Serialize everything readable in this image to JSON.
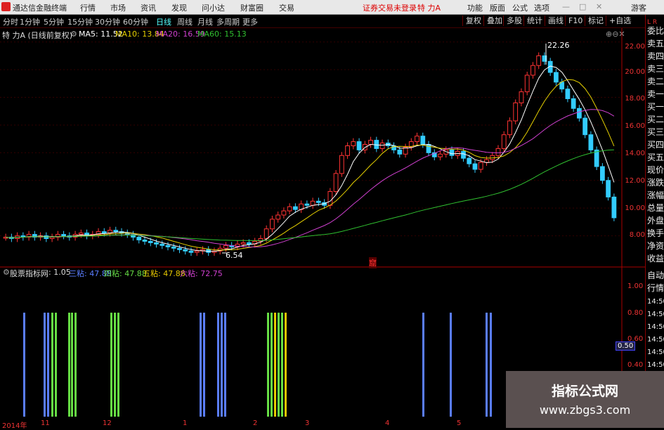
{
  "app": {
    "title": "通达信金融终端",
    "menus": [
      "行情",
      "市场",
      "资讯",
      "发现",
      "问小达",
      "财富圈",
      "交易"
    ],
    "status_warning": "证券交易未登录",
    "stock_name": "特 力A",
    "right_menus": [
      "功能",
      "版面",
      "公式",
      "选项"
    ],
    "user": "游客"
  },
  "period_tabs": [
    "分时",
    "1分钟",
    "5分钟",
    "15分钟",
    "30分钟",
    "60分钟",
    "日线",
    "周线",
    "月线",
    "多周期",
    "更多"
  ],
  "active_period": "日线",
  "right_tools": [
    "复权",
    "叠加",
    "多股",
    "统计",
    "画线",
    "F10",
    "标记",
    "+自选"
  ],
  "info_line": {
    "name": "特 力A (日线前复权)",
    "ma5": "MA5: 11.52",
    "ma10": "MA10: 13.84",
    "ma20": "MA20: 16.59",
    "ma60": "MA60: 15.13"
  },
  "price_axis": [
    "22.00",
    "20.00",
    "18.00",
    "16.00",
    "14.00",
    "12.00",
    "10.00",
    "8.00"
  ],
  "annotations": {
    "high": "22.26",
    "low": "6.54",
    "marker": "窟"
  },
  "indicator_line": {
    "name": "股票指标网",
    "v1": ": 1.05",
    "label3": "三粘: 47.88",
    "label4": "四粘: 47.88",
    "label5": "五粘: 47.88",
    "label6": "六粘: 72.75"
  },
  "indicator_axis": [
    "1.00",
    "0.80",
    "0.60",
    "0.50",
    "0.40"
  ],
  "time_axis": [
    "2014年",
    "11",
    "12",
    "1",
    "2",
    "3",
    "4",
    "5"
  ],
  "side_panel": [
    "委比",
    "卖五",
    "卖四",
    "卖三",
    "卖二",
    "卖一",
    "买一",
    "买二",
    "买三",
    "买四",
    "买五",
    "现价",
    "涨跌",
    "涨幅",
    "总量",
    "外盘",
    "换手",
    "净资",
    "收益"
  ],
  "side_panel_bottom": [
    "自动",
    "行情"
  ],
  "side_times": [
    "14:50",
    "14:50",
    "14:50",
    "14:50",
    "14:50",
    "14:50",
    "14:50"
  ],
  "corner_label": "L R",
  "watermark": {
    "line1": "指标公式网",
    "line2": "www.zbgs3.com"
  },
  "colors": {
    "up": "#ff3333",
    "down": "#33ccff",
    "ma5": "#ffffff",
    "ma10": "#e6d000",
    "ma20": "#d040d0",
    "ma60": "#30c030",
    "bar_blue": "#5a7dff",
    "bar_green": "#66dd44",
    "bar_yellow": "#e6c800"
  },
  "chart_data": {
    "type": "candlestick",
    "ylim": [
      6.0,
      23.0
    ],
    "close": [
      7.9,
      7.8,
      8.0,
      7.9,
      8.1,
      7.9,
      8.0,
      7.8,
      7.9,
      8.1,
      8.0,
      7.9,
      8.1,
      8.2,
      8.0,
      8.1,
      8.3,
      8.2,
      8.4,
      8.3,
      8.2,
      8.1,
      7.9,
      7.7,
      7.6,
      7.5,
      7.4,
      7.3,
      7.2,
      7.1,
      7.0,
      6.9,
      6.8,
      6.9,
      7.0,
      6.8,
      6.9,
      7.1,
      7.3,
      7.2,
      7.4,
      7.5,
      7.4,
      7.6,
      7.8,
      8.5,
      9.2,
      9.5,
      9.8,
      10.1,
      9.9,
      10.3,
      10.2,
      10.5,
      10.4,
      10.2,
      11.2,
      12.5,
      13.8,
      14.5,
      14.8,
      14.2,
      14.6,
      14.9,
      14.3,
      14.7,
      14.5,
      14.2,
      13.9,
      14.4,
      14.8,
      15.2,
      14.6,
      14.0,
      13.7,
      13.9,
      14.2,
      13.8,
      14.1,
      13.6,
      13.2,
      12.8,
      13.3,
      13.5,
      13.8,
      14.3,
      15.3,
      16.3,
      17.6,
      18.4,
      19.6,
      20.3,
      21.0,
      20.6,
      19.8,
      19.1,
      18.6,
      17.9,
      17.2,
      16.5,
      15.3,
      14.2,
      13.0,
      12.0,
      10.8,
      9.3
    ],
    "high_label": 22.26,
    "low_label": 6.54
  }
}
